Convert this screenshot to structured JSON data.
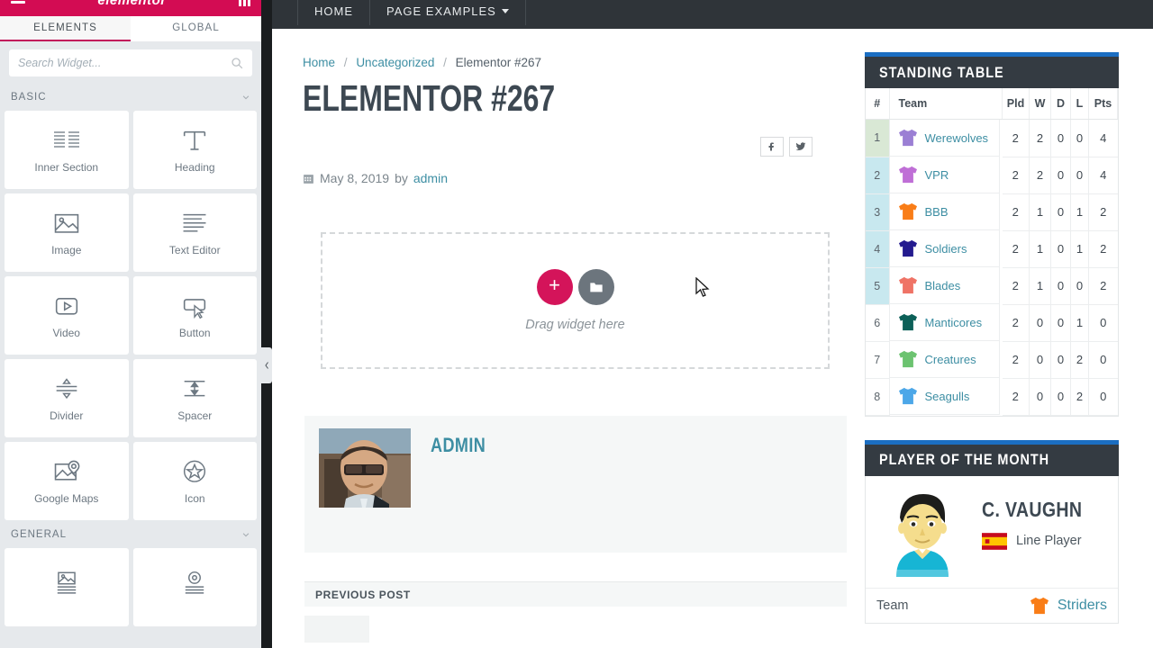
{
  "editor_panel": {
    "brand": "elementor",
    "burger_icon": "hamburger-menu-icon",
    "grid_icon": "grid-view-icon",
    "tabs": [
      {
        "label": "ELEMENTS",
        "active": true
      },
      {
        "label": "GLOBAL",
        "active": false
      }
    ],
    "search": {
      "placeholder": "Search Widget...",
      "value": "",
      "icon": "search-icon"
    },
    "categories": [
      {
        "label": "BASIC",
        "collapse_icon": "chevron-down-icon",
        "widgets": [
          {
            "label": "Inner Section",
            "icon": "columns-icon"
          },
          {
            "label": "Heading",
            "icon": "heading-t-icon"
          },
          {
            "label": "Image",
            "icon": "image-icon"
          },
          {
            "label": "Text Editor",
            "icon": "text-lines-icon"
          },
          {
            "label": "Video",
            "icon": "video-play-icon"
          },
          {
            "label": "Button",
            "icon": "button-cursor-icon"
          },
          {
            "label": "Divider",
            "icon": "divider-icon"
          },
          {
            "label": "Spacer",
            "icon": "spacer-arrows-icon"
          },
          {
            "label": "Google Maps",
            "icon": "map-pin-icon"
          },
          {
            "label": "Icon",
            "icon": "star-circle-icon"
          }
        ]
      },
      {
        "label": "GENERAL",
        "collapse_icon": "chevron-down-icon",
        "widgets": [
          {
            "label": "",
            "icon": "image-box-icon"
          },
          {
            "label": "",
            "icon": "icon-box-icon"
          }
        ]
      }
    ],
    "collapse_handle_icon": "chevron-left-icon"
  },
  "site": {
    "nav": [
      {
        "label": "HOME",
        "has_caret": false
      },
      {
        "label": "PAGE EXAMPLES",
        "has_caret": true
      }
    ],
    "breadcrumb": {
      "items": [
        "Home",
        "Uncategorized",
        "Elementor #267"
      ],
      "separator": "/"
    },
    "post": {
      "title": "ELEMENTOR #267",
      "date": "May 8, 2019",
      "by_label": "by",
      "author": "admin",
      "calendar_icon": "calendar-icon",
      "share": [
        {
          "name": "facebook-icon"
        },
        {
          "name": "twitter-icon"
        }
      ]
    },
    "dropzone": {
      "add_icon": "plus-icon",
      "folder_icon": "folder-icon",
      "label": "Drag widget here"
    },
    "author_box": {
      "name": "ADMIN",
      "avatar_icon": "author-photo"
    },
    "previous_post": {
      "label": "PREVIOUS POST"
    },
    "cursor_icon": "mouse-pointer-icon"
  },
  "sidebar_widgets": {
    "standing_table": {
      "title": "STANDING TABLE",
      "accent_color": "#1b6ec2",
      "header_color": "#343b42",
      "columns": [
        "#",
        "Team",
        "Pld",
        "W",
        "D",
        "L",
        "Pts"
      ],
      "rows": [
        {
          "rank": "1",
          "team": "Werewolves",
          "shirt": "#9b7fd4",
          "pld": "2",
          "w": "2",
          "d": "0",
          "l": "0",
          "pts": "4",
          "highlight": "green"
        },
        {
          "rank": "2",
          "team": "VPR",
          "shirt": "#bf6fd6",
          "pld": "2",
          "w": "2",
          "d": "0",
          "l": "0",
          "pts": "4",
          "highlight": "blue"
        },
        {
          "rank": "3",
          "team": "BBB",
          "shirt": "#f97d17",
          "pld": "2",
          "w": "1",
          "d": "0",
          "l": "1",
          "pts": "2",
          "highlight": "blue"
        },
        {
          "rank": "4",
          "team": "Soldiers",
          "shirt": "#241b8f",
          "pld": "2",
          "w": "1",
          "d": "0",
          "l": "1",
          "pts": "2",
          "highlight": "blue"
        },
        {
          "rank": "5",
          "team": "Blades",
          "shirt": "#ef7366",
          "pld": "2",
          "w": "1",
          "d": "0",
          "l": "0",
          "pts": "2",
          "highlight": "blue"
        },
        {
          "rank": "6",
          "team": "Manticores",
          "shirt": "#0c6058",
          "pld": "2",
          "w": "0",
          "d": "0",
          "l": "1",
          "pts": "0",
          "highlight": "none"
        },
        {
          "rank": "7",
          "team": "Creatures",
          "shirt": "#6cc370",
          "pld": "2",
          "w": "0",
          "d": "0",
          "l": "2",
          "pts": "0",
          "highlight": "none"
        },
        {
          "rank": "8",
          "team": "Seagulls",
          "shirt": "#4ca7e8",
          "pld": "2",
          "w": "0",
          "d": "0",
          "l": "2",
          "pts": "0",
          "highlight": "none"
        }
      ]
    },
    "player_of_month": {
      "title": "PLAYER OF THE MONTH",
      "accent_color": "#1b6ec2",
      "header_color": "#343b42",
      "player_name": "C. VAUGHN",
      "position": "Line Player",
      "flag_icon": "spain-flag-icon",
      "photo_icon": "player-avatar",
      "team_label": "Team",
      "team_name": "Striders",
      "team_shirt": "#f97d17"
    }
  }
}
